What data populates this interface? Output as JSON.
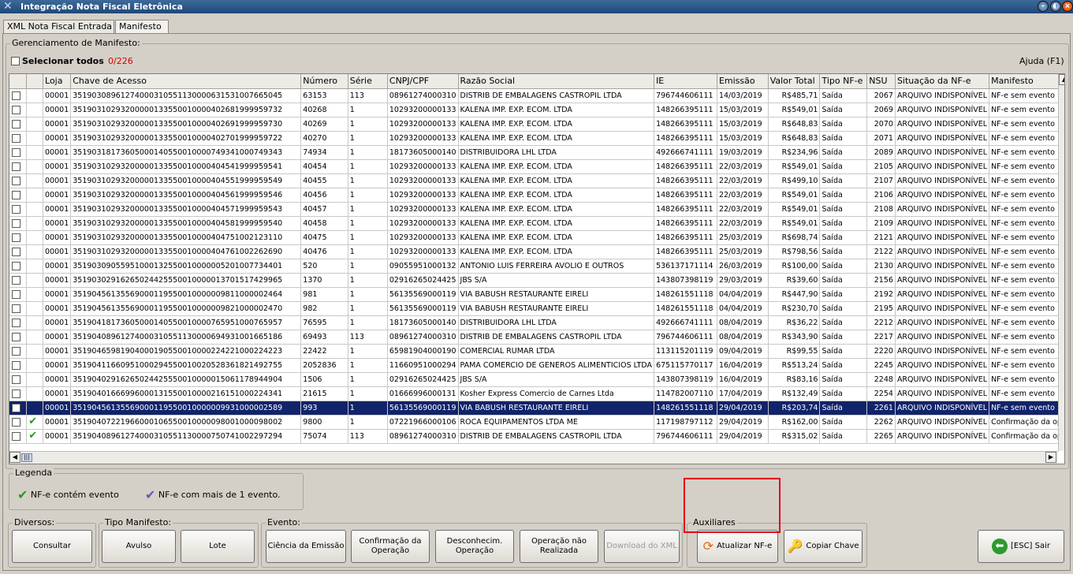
{
  "window": {
    "title": "Integração Nota Fiscal Eletrônica",
    "min": "–",
    "max": "◐",
    "close": "×"
  },
  "tabs": [
    {
      "label": "XML Nota Fiscal Entrada"
    },
    {
      "label": "Manifesto"
    }
  ],
  "manifest": {
    "group_label": "Gerenciamento de Manifesto:",
    "select_all_label": "Selecionar todos",
    "counter": "0/226",
    "help": "Ajuda (F1)"
  },
  "columns": [
    "",
    "",
    "Loja",
    "Chave de Acesso",
    "Número",
    "Série",
    "CNPJ/CPF",
    "Razão Social",
    "IE",
    "Emissão",
    "Valor Total",
    "Tipo NF-e",
    "NSU",
    "Situação da NF-e",
    "Manifesto"
  ],
  "rows": [
    {
      "loja": "00001",
      "chave": "35190308961274000310551130000631531007665045",
      "numero": "63153",
      "serie": "113",
      "cnpj": "08961274000310",
      "razao": "DISTRIB DE EMBALAGENS CASTROPIL LTDA",
      "ie": "796744606111",
      "emissao": "14/03/2019",
      "valor": "R$485,71",
      "tipo": "Saída",
      "nsu": "2067",
      "situacao": "ARQUIVO INDISPONÍVEL",
      "manifesto": "NF-e sem evento",
      "evento": ""
    },
    {
      "loja": "00001",
      "chave": "35190310293200000133550010000402681999959732",
      "numero": "40268",
      "serie": "1",
      "cnpj": "10293200000133",
      "razao": "KALENA IMP. EXP. ECOM. LTDA",
      "ie": "148266395111",
      "emissao": "15/03/2019",
      "valor": "R$549,01",
      "tipo": "Saída",
      "nsu": "2069",
      "situacao": "ARQUIVO INDISPONÍVEL",
      "manifesto": "NF-e sem evento",
      "evento": ""
    },
    {
      "loja": "00001",
      "chave": "35190310293200000133550010000402691999959730",
      "numero": "40269",
      "serie": "1",
      "cnpj": "10293200000133",
      "razao": "KALENA IMP. EXP. ECOM. LTDA",
      "ie": "148266395111",
      "emissao": "15/03/2019",
      "valor": "R$648,83",
      "tipo": "Saída",
      "nsu": "2070",
      "situacao": "ARQUIVO INDISPONÍVEL",
      "manifesto": "NF-e sem evento",
      "evento": ""
    },
    {
      "loja": "00001",
      "chave": "35190310293200000133550010000402701999959722",
      "numero": "40270",
      "serie": "1",
      "cnpj": "10293200000133",
      "razao": "KALENA IMP. EXP. ECOM. LTDA",
      "ie": "148266395111",
      "emissao": "15/03/2019",
      "valor": "R$648,83",
      "tipo": "Saída",
      "nsu": "2071",
      "situacao": "ARQUIVO INDISPONÍVEL",
      "manifesto": "NF-e sem evento",
      "evento": ""
    },
    {
      "loja": "00001",
      "chave": "35190318173605000140550010000749341000749343",
      "numero": "74934",
      "serie": "1",
      "cnpj": "18173605000140",
      "razao": "DISTRIBUIDORA LHL LTDA",
      "ie": "492666741111",
      "emissao": "19/03/2019",
      "valor": "R$234,96",
      "tipo": "Saída",
      "nsu": "2089",
      "situacao": "ARQUIVO INDISPONÍVEL",
      "manifesto": "NF-e sem evento",
      "evento": ""
    },
    {
      "loja": "00001",
      "chave": "35190310293200000133550010000404541999959541",
      "numero": "40454",
      "serie": "1",
      "cnpj": "10293200000133",
      "razao": "KALENA IMP. EXP. ECOM. LTDA",
      "ie": "148266395111",
      "emissao": "22/03/2019",
      "valor": "R$549,01",
      "tipo": "Saída",
      "nsu": "2105",
      "situacao": "ARQUIVO INDISPONÍVEL",
      "manifesto": "NF-e sem evento",
      "evento": ""
    },
    {
      "loja": "00001",
      "chave": "35190310293200000133550010000404551999959549",
      "numero": "40455",
      "serie": "1",
      "cnpj": "10293200000133",
      "razao": "KALENA IMP. EXP. ECOM. LTDA",
      "ie": "148266395111",
      "emissao": "22/03/2019",
      "valor": "R$499,10",
      "tipo": "Saída",
      "nsu": "2107",
      "situacao": "ARQUIVO INDISPONÍVEL",
      "manifesto": "NF-e sem evento",
      "evento": ""
    },
    {
      "loja": "00001",
      "chave": "35190310293200000133550010000404561999959546",
      "numero": "40456",
      "serie": "1",
      "cnpj": "10293200000133",
      "razao": "KALENA IMP. EXP. ECOM. LTDA",
      "ie": "148266395111",
      "emissao": "22/03/2019",
      "valor": "R$549,01",
      "tipo": "Saída",
      "nsu": "2106",
      "situacao": "ARQUIVO INDISPONÍVEL",
      "manifesto": "NF-e sem evento",
      "evento": ""
    },
    {
      "loja": "00001",
      "chave": "35190310293200000133550010000404571999959543",
      "numero": "40457",
      "serie": "1",
      "cnpj": "10293200000133",
      "razao": "KALENA IMP. EXP. ECOM. LTDA",
      "ie": "148266395111",
      "emissao": "22/03/2019",
      "valor": "R$549,01",
      "tipo": "Saída",
      "nsu": "2108",
      "situacao": "ARQUIVO INDISPONÍVEL",
      "manifesto": "NF-e sem evento",
      "evento": ""
    },
    {
      "loja": "00001",
      "chave": "35190310293200000133550010000404581999959540",
      "numero": "40458",
      "serie": "1",
      "cnpj": "10293200000133",
      "razao": "KALENA IMP. EXP. ECOM. LTDA",
      "ie": "148266395111",
      "emissao": "22/03/2019",
      "valor": "R$549,01",
      "tipo": "Saída",
      "nsu": "2109",
      "situacao": "ARQUIVO INDISPONÍVEL",
      "manifesto": "NF-e sem evento",
      "evento": ""
    },
    {
      "loja": "00001",
      "chave": "35190310293200000133550010000404751002123110",
      "numero": "40475",
      "serie": "1",
      "cnpj": "10293200000133",
      "razao": "KALENA IMP. EXP. ECOM. LTDA",
      "ie": "148266395111",
      "emissao": "25/03/2019",
      "valor": "R$698,74",
      "tipo": "Saída",
      "nsu": "2121",
      "situacao": "ARQUIVO INDISPONÍVEL",
      "manifesto": "NF-e sem evento",
      "evento": ""
    },
    {
      "loja": "00001",
      "chave": "35190310293200000133550010000404761002262690",
      "numero": "40476",
      "serie": "1",
      "cnpj": "10293200000133",
      "razao": "KALENA IMP. EXP. ECOM. LTDA",
      "ie": "148266395111",
      "emissao": "25/03/2019",
      "valor": "R$798,56",
      "tipo": "Saída",
      "nsu": "2122",
      "situacao": "ARQUIVO INDISPONÍVEL",
      "manifesto": "NF-e sem evento",
      "evento": ""
    },
    {
      "loja": "00001",
      "chave": "35190309055951000132550010000005201007734401",
      "numero": "520",
      "serie": "1",
      "cnpj": "09055951000132",
      "razao": "ANTONIO LUIS FERREIRA AVOLIO E OUTROS",
      "ie": "536137171114",
      "emissao": "26/03/2019",
      "valor": "R$100,00",
      "tipo": "Saída",
      "nsu": "2130",
      "situacao": "ARQUIVO INDISPONÍVEL",
      "manifesto": "NF-e sem evento",
      "evento": ""
    },
    {
      "loja": "00001",
      "chave": "35190302916265024425550010000013701517429965",
      "numero": "1370",
      "serie": "1",
      "cnpj": "02916265024425",
      "razao": "JBS S/A",
      "ie": "143807398119",
      "emissao": "29/03/2019",
      "valor": "R$39,60",
      "tipo": "Saída",
      "nsu": "2156",
      "situacao": "ARQUIVO INDISPONÍVEL",
      "manifesto": "NF-e sem evento",
      "evento": ""
    },
    {
      "loja": "00001",
      "chave": "35190456135569000119550010000009811000002464",
      "numero": "981",
      "serie": "1",
      "cnpj": "56135569000119",
      "razao": "VIA BABUSH RESTAURANTE EIRELI",
      "ie": "148261551118",
      "emissao": "04/04/2019",
      "valor": "R$447,90",
      "tipo": "Saída",
      "nsu": "2192",
      "situacao": "ARQUIVO INDISPONÍVEL",
      "manifesto": "NF-e sem evento",
      "evento": ""
    },
    {
      "loja": "00001",
      "chave": "35190456135569000119550010000009821000002470",
      "numero": "982",
      "serie": "1",
      "cnpj": "56135569000119",
      "razao": "VIA BABUSH RESTAURANTE EIRELI",
      "ie": "148261551118",
      "emissao": "04/04/2019",
      "valor": "R$230,70",
      "tipo": "Saída",
      "nsu": "2195",
      "situacao": "ARQUIVO INDISPONÍVEL",
      "manifesto": "NF-e sem evento",
      "evento": ""
    },
    {
      "loja": "00001",
      "chave": "35190418173605000140550010000765951000765957",
      "numero": "76595",
      "serie": "1",
      "cnpj": "18173605000140",
      "razao": "DISTRIBUIDORA LHL LTDA",
      "ie": "492666741111",
      "emissao": "08/04/2019",
      "valor": "R$36,22",
      "tipo": "Saída",
      "nsu": "2212",
      "situacao": "ARQUIVO INDISPONÍVEL",
      "manifesto": "NF-e sem evento",
      "evento": ""
    },
    {
      "loja": "00001",
      "chave": "35190408961274000310551130000694931001665186",
      "numero": "69493",
      "serie": "113",
      "cnpj": "08961274000310",
      "razao": "DISTRIB DE EMBALAGENS CASTROPIL LTDA",
      "ie": "796744606111",
      "emissao": "08/04/2019",
      "valor": "R$343,90",
      "tipo": "Saída",
      "nsu": "2217",
      "situacao": "ARQUIVO INDISPONÍVEL",
      "manifesto": "NF-e sem evento",
      "evento": ""
    },
    {
      "loja": "00001",
      "chave": "35190465981904000190550010000224221000224223",
      "numero": "22422",
      "serie": "1",
      "cnpj": "65981904000190",
      "razao": "COMERCIAL RUMAR LTDA",
      "ie": "113115201119",
      "emissao": "09/04/2019",
      "valor": "R$99,55",
      "tipo": "Saída",
      "nsu": "2220",
      "situacao": "ARQUIVO INDISPONÍVEL",
      "manifesto": "NF-e sem evento",
      "evento": ""
    },
    {
      "loja": "00001",
      "chave": "35190411660951000294550010020528361821492755",
      "numero": "2052836",
      "serie": "1",
      "cnpj": "11660951000294",
      "razao": "PAMA COMERCIO DE GENEROS ALIMENTICIOS LTDA",
      "ie": "675115770117",
      "emissao": "16/04/2019",
      "valor": "R$513,24",
      "tipo": "Saída",
      "nsu": "2245",
      "situacao": "ARQUIVO INDISPONÍVEL",
      "manifesto": "NF-e sem evento",
      "evento": ""
    },
    {
      "loja": "00001",
      "chave": "35190402916265024425550010000015061178944904",
      "numero": "1506",
      "serie": "1",
      "cnpj": "02916265024425",
      "razao": "JBS S/A",
      "ie": "143807398119",
      "emissao": "16/04/2019",
      "valor": "R$83,16",
      "tipo": "Saída",
      "nsu": "2248",
      "situacao": "ARQUIVO INDISPONÍVEL",
      "manifesto": "NF-e sem evento",
      "evento": ""
    },
    {
      "loja": "00001",
      "chave": "35190401666996000131550010000216151000224341",
      "numero": "21615",
      "serie": "1",
      "cnpj": "01666996000131",
      "razao": "Kosher Express Comercio de Carnes Ltda",
      "ie": "114782007110",
      "emissao": "17/04/2019",
      "valor": "R$132,49",
      "tipo": "Saída",
      "nsu": "2254",
      "situacao": "ARQUIVO INDISPONÍVEL",
      "manifesto": "NF-e sem evento",
      "evento": ""
    },
    {
      "loja": "00001",
      "chave": "35190456135569000119550010000009931000002589",
      "numero": "993",
      "serie": "1",
      "cnpj": "56135569000119",
      "razao": "VIA BABUSH RESTAURANTE EIRELI",
      "ie": "148261551118",
      "emissao": "29/04/2019",
      "valor": "R$203,74",
      "tipo": "Saída",
      "nsu": "2261",
      "situacao": "ARQUIVO INDISPONÍVEL",
      "manifesto": "NF-e sem evento",
      "evento": "",
      "selected": true
    },
    {
      "loja": "00001",
      "chave": "35190407221966000106550010000098001000098002",
      "numero": "9800",
      "serie": "1",
      "cnpj": "07221966000106",
      "razao": "ROCA EQUIPAMENTOS LTDA  ME",
      "ie": "117198797112",
      "emissao": "29/04/2019",
      "valor": "R$162,00",
      "tipo": "Saída",
      "nsu": "2262",
      "situacao": "ARQUIVO INDISPONÍVEL",
      "manifesto": "Confirmação da op",
      "evento": "✔"
    },
    {
      "loja": "00001",
      "chave": "35190408961274000310551130000750741002297294",
      "numero": "75074",
      "serie": "113",
      "cnpj": "08961274000310",
      "razao": "DISTRIB DE EMBALAGENS CASTROPIL LTDA",
      "ie": "796744606111",
      "emissao": "29/04/2019",
      "valor": "R$315,02",
      "tipo": "Saída",
      "nsu": "2265",
      "situacao": "ARQUIVO INDISPONÍVEL",
      "manifesto": "Confirmação da op",
      "evento": "✔"
    }
  ],
  "legend": {
    "label": "Legenda",
    "item1": "NF-e contém evento",
    "item2": "NF-e com mais de 1 evento.",
    "icon1": "✔",
    "icon2": "✔"
  },
  "groups": {
    "diversos": "Diversos:",
    "tipo_manifesto": "Tipo Manifesto:",
    "evento": "Evento:",
    "auxiliares": "Auxiliares"
  },
  "buttons": {
    "consultar": "Consultar",
    "avulso": "Avulso",
    "lote": "Lote",
    "ciencia": "Ciência da Emissão",
    "confirmacao": "Confirmação da\nOperação",
    "desconhecimento": "Desconhecim.\nOperação",
    "operacao_nao": "Operação não\nRealizada",
    "download_xml": "Download do XML",
    "atualizar": "Atualizar NF-e",
    "copiar_chave": "Copiar Chave",
    "sair": "[ESC] Sair"
  },
  "icons": {
    "atualizar": "⟳",
    "copiar": "🔑",
    "sair": "⬅"
  },
  "colors": {
    "selected_row": "#11236a",
    "counter": "#d40000",
    "highlight": "#e0001b"
  }
}
